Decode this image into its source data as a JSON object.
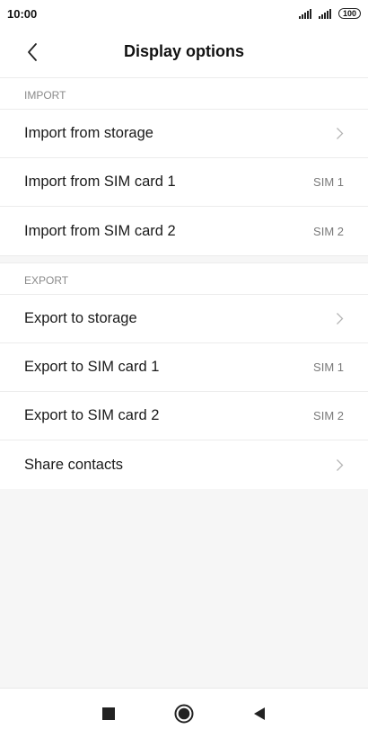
{
  "status_bar": {
    "time": "10:00",
    "battery": "100"
  },
  "header": {
    "title": "Display options",
    "back_icon": "chevron-left-icon"
  },
  "sections": [
    {
      "header": "IMPORT",
      "rows": [
        {
          "label": "Import from storage",
          "trailing": "chevron-right-icon"
        },
        {
          "label": "Import from SIM card 1",
          "value": "SIM 1"
        },
        {
          "label": "Import from SIM card 2",
          "value": "SIM 2"
        }
      ]
    },
    {
      "header": "EXPORT",
      "rows": [
        {
          "label": "Export to storage",
          "trailing": "chevron-right-icon"
        },
        {
          "label": "Export to SIM card 1",
          "value": "SIM 1"
        },
        {
          "label": "Export to SIM card 2",
          "value": "SIM 2"
        },
        {
          "label": "Share contacts",
          "trailing": "chevron-right-icon"
        }
      ]
    }
  ],
  "nav_bar": {
    "icons": [
      "recents-square-icon",
      "home-circle-icon",
      "back-triangle-icon"
    ]
  },
  "colors": {
    "background": "#f6f6f6",
    "surface": "#ffffff",
    "divider": "#ececec",
    "secondary_text": "#8a8a8a"
  }
}
